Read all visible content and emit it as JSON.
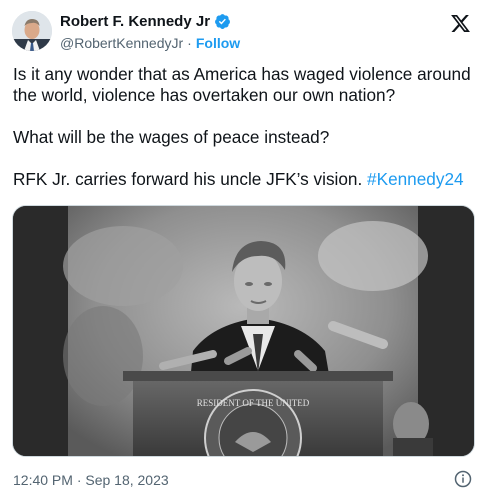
{
  "author": {
    "display_name": "Robert F. Kennedy Jr",
    "handle": "@RobertKennedyJr",
    "separator": "·",
    "follow_label": "Follow"
  },
  "tweet": {
    "paragraph1": "Is it any wonder that as America has waged violence around the world, violence has overtaken our own nation?",
    "paragraph2": "What will be the wages of peace instead?",
    "paragraph3_text": "RFK Jr. carries forward his uncle JFK’s vision. ",
    "hashtag": "#Kennedy24"
  },
  "media": {
    "seal_text": "RESIDENT OF THE UNITED"
  },
  "footer": {
    "timestamp": "12:40 PM · Sep 18, 2023"
  },
  "colors": {
    "accent": "#1d9bf0",
    "text": "#0f1419",
    "secondary": "#536471"
  },
  "icons": [
    "verified-badge-icon",
    "x-logo-icon",
    "info-icon"
  ]
}
